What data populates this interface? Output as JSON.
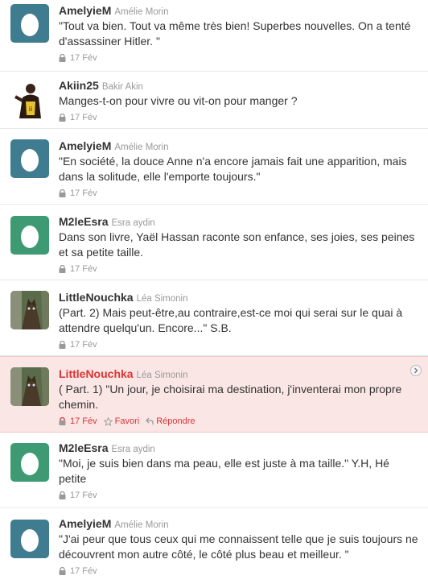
{
  "tweets": [
    {
      "screen_name": "AmelyieM",
      "full_name": "Amélie Morin",
      "text": "\"Tout va bien. Tout va même très bien! Superbes nouvelles. On a tenté d'assassiner Hitler. \"",
      "date": "17 Fév",
      "avatar": "egg-blue-icon"
    },
    {
      "screen_name": "Akiin25",
      "full_name": "Bakir Akin",
      "text": "Manges-t-on pour vivre ou vit-on pour manger ?",
      "date": "17 Fév",
      "avatar": "basketball-player-photo"
    },
    {
      "screen_name": "AmelyieM",
      "full_name": "Amélie Morin",
      "text": "\"En société, la douce Anne n'a encore jamais fait une apparition, mais dans la solitude, elle l'emporte toujours.\"",
      "date": "17 Fév",
      "avatar": "egg-blue-icon"
    },
    {
      "screen_name": "M2leEsra",
      "full_name": "Esra aydin",
      "text": "Dans son livre, Yaël Hassan raconte son enfance, ses joies, ses peines et sa petite taille.",
      "date": "17 Fév",
      "avatar": "egg-green-icon"
    },
    {
      "screen_name": "LittleNouchka",
      "full_name": "Léa Simonin",
      "text": "(Part. 2) Mais peut-être,au contraire,est-ce moi qui serai sur le quai à attendre quelqu'un. Encore...\" S.B.",
      "date": "17 Fév",
      "avatar": "cat-photo"
    },
    {
      "screen_name": "LittleNouchka",
      "full_name": "Léa Simonin",
      "text": "( Part. 1) \"Un jour, je choisirai ma destination, j'inventerai mon propre chemin.",
      "date": "17 Fév",
      "avatar": "cat-photo",
      "favorite_label": "Favori",
      "reply_label": "Répondre"
    },
    {
      "screen_name": "M2leEsra",
      "full_name": "Esra aydin",
      "text": "\"Moi, je suis bien dans ma peau, elle est juste à ma taille.\" Y.H, Hé petite",
      "date": "17 Fév",
      "avatar": "egg-green-icon"
    },
    {
      "screen_name": "AmelyieM",
      "full_name": "Amélie Morin",
      "text": "\"J'ai peur que tous ceux qui me connaissent telle que je suis toujours ne découvrent mon autre côté, le côté plus beau et meilleur. \"",
      "date": "17 Fév",
      "avatar": "egg-blue-icon"
    }
  ],
  "colors": {
    "egg_blue": "#3f7c8f",
    "egg_green": "#3d9a73",
    "highlight_bg": "#fbe6e6",
    "highlight_text": "#dd3333"
  }
}
